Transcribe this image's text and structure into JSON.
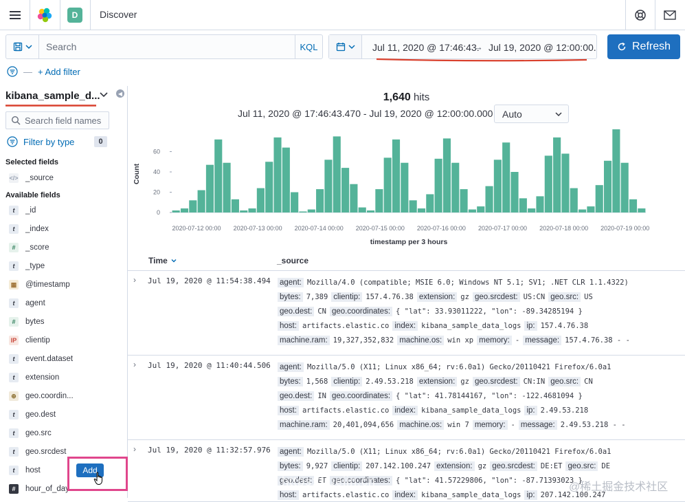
{
  "header": {
    "app_title": "Discover",
    "space_initial": "D",
    "logo_colors": [
      "#f04e98",
      "#fec514",
      "#00bfb3",
      "#1ba9f5",
      "#93c90e",
      "#07c"
    ],
    "menu_icon": "menu-icon",
    "help_icon": "help-icon",
    "mail_icon": "mail-icon"
  },
  "query": {
    "placeholder": "Search",
    "language": "KQL"
  },
  "date": {
    "start": "Jul 11, 2020 @ 17:46:43.",
    "arrow": "→",
    "end": "Jul 19, 2020 @ 12:00:00."
  },
  "refresh_label": "Refresh",
  "add_filter_label": "+ Add filter",
  "sidebar": {
    "index_pattern": "kibana_sample_d...",
    "field_search_placeholder": "Search field names",
    "filter_by_type": "Filter by type",
    "filter_count": "0",
    "selected_title": "Selected fields",
    "selected": [
      {
        "name": "_source",
        "type": "src",
        "glyph": "</>"
      }
    ],
    "available_title": "Available fields",
    "available": [
      {
        "name": "_id",
        "type": "str",
        "glyph": "t"
      },
      {
        "name": "_index",
        "type": "str",
        "glyph": "t"
      },
      {
        "name": "_score",
        "type": "num",
        "glyph": "#"
      },
      {
        "name": "_type",
        "type": "str",
        "glyph": "t"
      },
      {
        "name": "@timestamp",
        "type": "date",
        "glyph": "▦"
      },
      {
        "name": "agent",
        "type": "str",
        "glyph": "t"
      },
      {
        "name": "bytes",
        "type": "num",
        "glyph": "#"
      },
      {
        "name": "clientip",
        "type": "ip",
        "glyph": "IP"
      },
      {
        "name": "event.dataset",
        "type": "str",
        "glyph": "t"
      },
      {
        "name": "extension",
        "type": "str",
        "glyph": "t"
      },
      {
        "name": "geo.coordin...",
        "type": "geo",
        "glyph": "⊕"
      },
      {
        "name": "geo.dest",
        "type": "str",
        "glyph": "t"
      },
      {
        "name": "geo.src",
        "type": "str",
        "glyph": "t"
      },
      {
        "name": "geo.srcdest",
        "type": "str",
        "glyph": "t"
      },
      {
        "name": "host",
        "type": "str",
        "glyph": "t"
      },
      {
        "name": "hour_of_day",
        "type": "numdark",
        "glyph": "#"
      }
    ],
    "add_button": "Add"
  },
  "results": {
    "hits_count": "1,640",
    "hits_label": "hits",
    "range_text": "Jul 11, 2020 @ 17:46:43.470 - Jul 19, 2020 @ 12:00:00.000 —",
    "interval": "Auto"
  },
  "chart_data": {
    "type": "bar",
    "title": "",
    "xlabel": "timestamp per 3 hours",
    "ylabel": "Count",
    "ylim": [
      0,
      80
    ],
    "yticks": [
      0,
      20,
      40,
      60
    ],
    "color": "#54b399",
    "x_tick_labels": [
      "2020-07-12 00:00",
      "2020-07-13 00:00",
      "2020-07-14 00:00",
      "2020-07-15 00:00",
      "2020-07-16 00:00",
      "2020-07-17 00:00",
      "2020-07-18 00:00",
      "2020-07-19 00:00"
    ],
    "values": [
      2,
      4,
      12,
      22,
      47,
      72,
      49,
      13,
      2,
      4,
      24,
      50,
      74,
      64,
      20,
      1,
      3,
      23,
      52,
      75,
      44,
      28,
      5,
      2,
      23,
      54,
      72,
      49,
      12,
      4,
      18,
      53,
      73,
      49,
      23,
      3,
      6,
      26,
      52,
      69,
      40,
      14,
      4,
      16,
      56,
      74,
      58,
      24,
      3,
      6,
      27,
      51,
      82,
      49,
      13,
      4
    ]
  },
  "table": {
    "col_time": "Time",
    "sort_icon": "sort-down-icon",
    "col_source": "_source",
    "docs": [
      {
        "time": "Jul 19, 2020 @ 11:54:38.494",
        "lines": [
          [
            [
              "agent:",
              "Mozilla/4.0 (compatible; MSIE 6.0; Windows NT 5.1; SV1; .NET CLR 1.1.4322)"
            ]
          ],
          [
            [
              "bytes:",
              "7,389"
            ],
            [
              "clientip:",
              "157.4.76.38"
            ],
            [
              "extension:",
              "gz"
            ],
            [
              "geo.srcdest:",
              "US:CN"
            ],
            [
              "geo.src:",
              "US"
            ]
          ],
          [
            [
              "geo.dest:",
              "CN"
            ],
            [
              "geo.coordinates:",
              "{ \"lat\": 33.93011222, \"lon\": -89.34285194 }"
            ]
          ],
          [
            [
              "host:",
              "artifacts.elastic.co"
            ],
            [
              "index:",
              "kibana_sample_data_logs"
            ],
            [
              "ip:",
              "157.4.76.38"
            ]
          ],
          [
            [
              "machine.ram:",
              "19,327,352,832"
            ],
            [
              "machine.os:",
              "win xp"
            ],
            [
              "memory:",
              " - "
            ],
            [
              "message:",
              "157.4.76.38 - -"
            ]
          ]
        ]
      },
      {
        "time": "Jul 19, 2020 @ 11:40:44.506",
        "lines": [
          [
            [
              "agent:",
              "Mozilla/5.0 (X11; Linux x86_64; rv:6.0a1) Gecko/20110421 Firefox/6.0a1"
            ]
          ],
          [
            [
              "bytes:",
              "1,568"
            ],
            [
              "clientip:",
              "2.49.53.218"
            ],
            [
              "extension:",
              "gz"
            ],
            [
              "geo.srcdest:",
              "CN:IN"
            ],
            [
              "geo.src:",
              "CN"
            ]
          ],
          [
            [
              "geo.dest:",
              "IN"
            ],
            [
              "geo.coordinates:",
              "{ \"lat\": 41.78144167, \"lon\": -122.4681094 }"
            ]
          ],
          [
            [
              "host:",
              "artifacts.elastic.co"
            ],
            [
              "index:",
              "kibana_sample_data_logs"
            ],
            [
              "ip:",
              "2.49.53.218"
            ]
          ],
          [
            [
              "machine.ram:",
              "20,401,094,656"
            ],
            [
              "machine.os:",
              "win 7"
            ],
            [
              "memory:",
              " - "
            ],
            [
              "message:",
              "2.49.53.218 - -"
            ]
          ]
        ]
      },
      {
        "time": "Jul 19, 2020 @ 11:32:57.976",
        "lines": [
          [
            [
              "agent:",
              "Mozilla/5.0 (X11; Linux x86_64; rv:6.0a1) Gecko/20110421 Firefox/6.0a1"
            ]
          ],
          [
            [
              "bytes:",
              "9,927"
            ],
            [
              "clientip:",
              "207.142.100.247"
            ],
            [
              "extension:",
              "gz"
            ],
            [
              "geo.srcdest:",
              "DE:ET"
            ],
            [
              "geo.src:",
              "DE"
            ]
          ],
          [
            [
              "geo.dest:",
              "ET"
            ],
            [
              "geo.coordinates:",
              "{ \"lat\": 41.57229806, \"lon\": -87.71393023 }"
            ]
          ],
          [
            [
              "host:",
              "artifacts.elastic.co"
            ],
            [
              "index:",
              "kibana_sample_data_logs"
            ],
            [
              "ip:",
              "207.142.100.247"
            ]
          ]
        ]
      }
    ]
  },
  "watermark": "@稀土掘金技术社区"
}
